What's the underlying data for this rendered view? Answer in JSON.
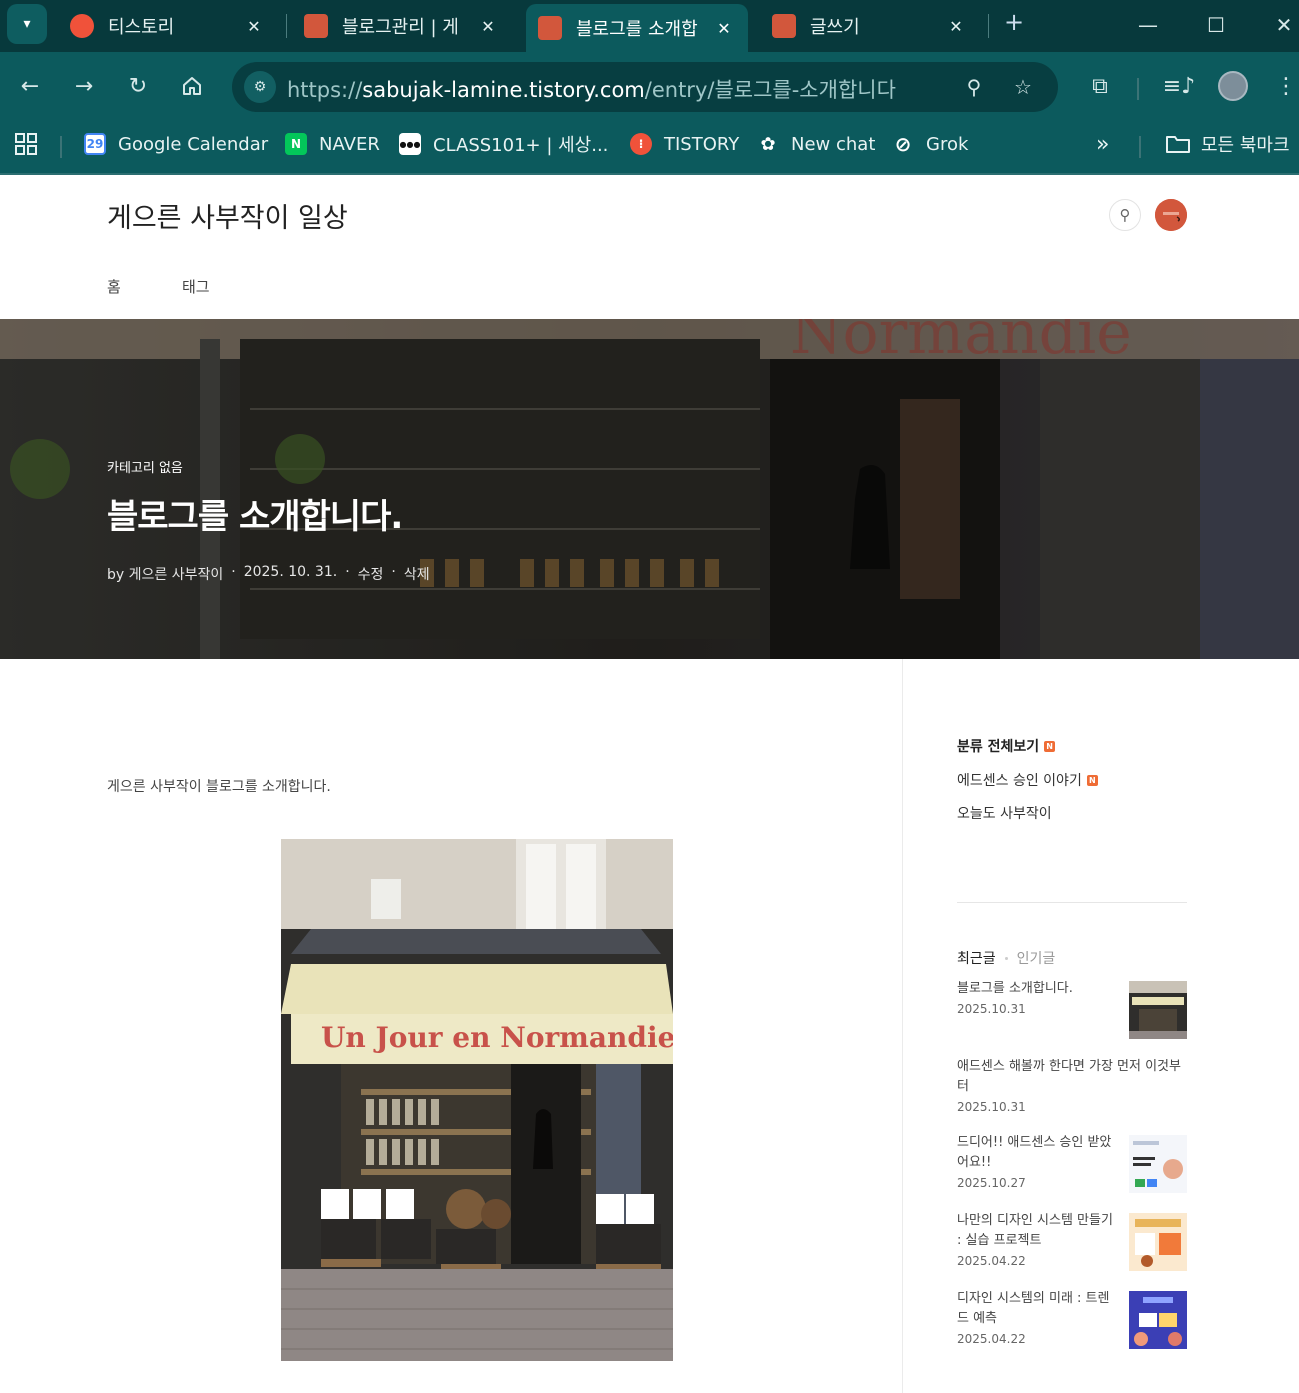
{
  "browser": {
    "tabs": [
      {
        "title": "티스토리",
        "favicon_color": "#f0523a"
      },
      {
        "title": "블로그관리 | 게",
        "favicon_color": "#d2573c"
      },
      {
        "title": "블로그를 소개합",
        "favicon_color": "#d2573c"
      },
      {
        "title": "글쓰기",
        "favicon_color": "#d2573c"
      }
    ],
    "url_scheme": "https://",
    "url_host": "sabujak-lamine.tistory.com",
    "url_path": "/entry/블로그를-소개합니다",
    "bookmarks": [
      {
        "label": "Google Calendar",
        "icon": "google-calendar-icon",
        "badge": "29",
        "color": "#4285f4"
      },
      {
        "label": "NAVER",
        "icon": "naver-icon",
        "badge": "N",
        "color": "#03c75a"
      },
      {
        "label": "CLASS101+ | 세상...",
        "icon": "class101-icon",
        "badge": "101",
        "color": "#111111"
      },
      {
        "label": "TISTORY",
        "icon": "tistory-icon",
        "badge": "T",
        "color": "#f0523a"
      },
      {
        "label": "New chat",
        "icon": "openai-icon",
        "badge": "⚙",
        "color": "#0c5a5d"
      },
      {
        "label": "Grok",
        "icon": "grok-icon",
        "badge": "⊘",
        "color": "#0c5a5d"
      }
    ],
    "all_bookmarks": "모든 북마크",
    "colors": {
      "frame": "#07393c",
      "toolbar": "#0c5a5d"
    }
  },
  "blog": {
    "title": "게으른 사부작이 일상",
    "menu": [
      "홈",
      "태그"
    ],
    "hero": {
      "category": "카테고리 없음",
      "title": "블로그를 소개합니다.",
      "author": "by 게으른 사부작이",
      "date": "2025. 10. 31.",
      "edit": "수정",
      "delete": "삭제",
      "awning_text": "Normandie"
    },
    "body_text": "게으른 사부작이 블로그를 소개합니다.",
    "image_awning": "Un Jour en Normandie"
  },
  "sidebar": {
    "categories": [
      {
        "label": "분류 전체보기",
        "new": "N"
      },
      {
        "label": "에드센스 승인 이야기",
        "new": "N"
      },
      {
        "label": "오늘도 사부작이",
        "new": ""
      }
    ],
    "tabs": {
      "recent": "최근글",
      "popular": "인기글"
    },
    "recent_posts": [
      {
        "title": "블로그를 소개합니다.",
        "date": "2025.10.31"
      },
      {
        "title": "애드센스 해볼까 한다면 가장 먼저 이것부터",
        "date": "2025.10.31"
      },
      {
        "title": "드디어!! 애드센스 승인 받았어요!!",
        "date": "2025.10.27"
      },
      {
        "title": "나만의 디자인 시스템 만들기 : 실습 프로젝트",
        "date": "2025.04.22"
      },
      {
        "title": "디자인 시스템의 미래 : 트렌드 예측",
        "date": "2025.04.22"
      }
    ]
  }
}
